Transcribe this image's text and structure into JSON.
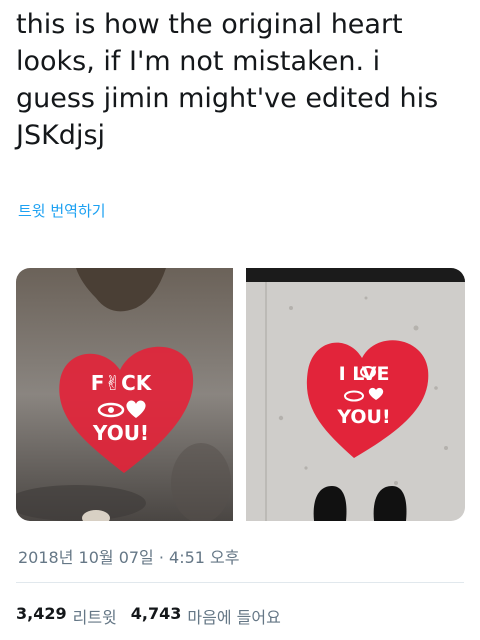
{
  "tweet": {
    "text": "this is how the original heart\nlooks, if I'm not mistaken. i\nguess jimin might've edited his\nJSKdjsj",
    "translate_label": "트윗 번역하기",
    "timestamp": "2018년 10월 07일 · 4:51 오후"
  },
  "media": {
    "left_image": {
      "top_word": "F✌CK",
      "bottom_word": "YOU!"
    },
    "right_image": {
      "top_word": "I LVE",
      "bottom_word": "YOU!"
    }
  },
  "stats": {
    "retweets_count": "3,429",
    "retweets_label": "리트윗",
    "likes_count": "4,743",
    "likes_label": "마음에 들어요"
  },
  "colors": {
    "link": "#1da1f2",
    "secondary_text": "#657786",
    "heart_red": "#e2243a"
  }
}
